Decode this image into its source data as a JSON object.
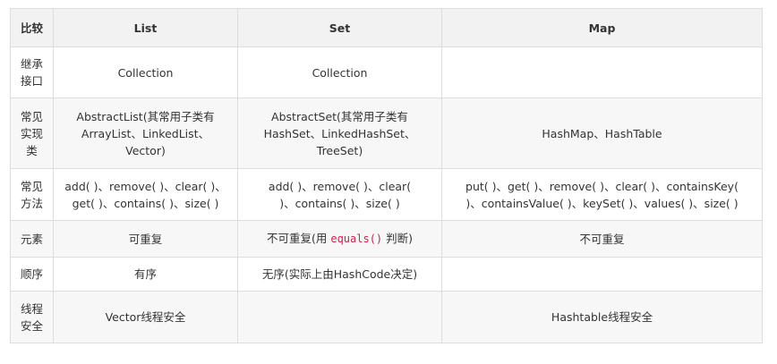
{
  "header": {
    "compare": "比较",
    "list": "List",
    "set": "Set",
    "map": "Map"
  },
  "rows": [
    {
      "label": "继承接口",
      "list": "Collection",
      "set": "Collection",
      "map": ""
    },
    {
      "label": "常见实现类",
      "list": "AbstractList(其常用子类有ArrayList、LinkedList、Vector)",
      "set": "AbstractSet(其常用子类有HashSet、LinkedHashSet、TreeSet)",
      "map": "HashMap、HashTable"
    },
    {
      "label": "常见方法",
      "list": "add( )、remove( )、clear( )、get( )、contains( )、size( )",
      "set": "add( )、remove( )、clear( )、contains( )、size( )",
      "map": "put( )、get( )、remove( )、clear( )、containsKey( )、containsValue( )、keySet( )、values( )、size( )"
    },
    {
      "label": "元素",
      "list": "可重复",
      "set_pre": "不可重复(用 ",
      "set_code": "equals()",
      "set_post": " 判断)",
      "map": "不可重复"
    },
    {
      "label": "顺序",
      "list": "有序",
      "set": "无序(实际上由HashCode决定)",
      "map": ""
    },
    {
      "label": "线程安全",
      "list": "Vector线程安全",
      "set": "",
      "map": "Hashtable线程安全"
    }
  ]
}
